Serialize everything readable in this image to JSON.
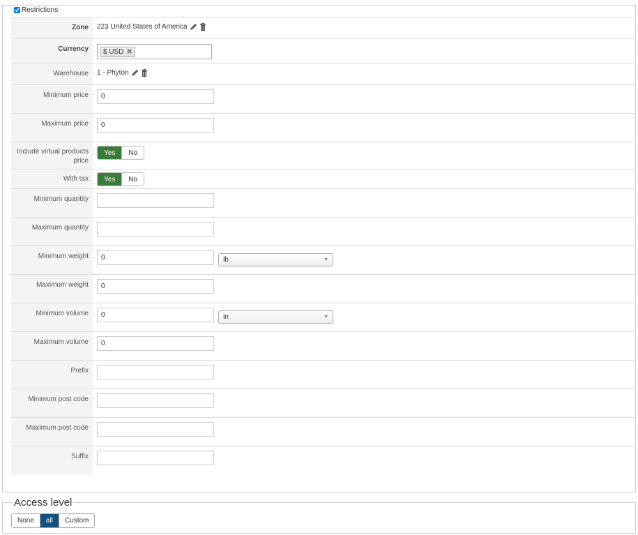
{
  "restrictions": {
    "legend": "Restrictions",
    "checked": true,
    "zone": {
      "label": "Zone",
      "value": "223 United States of America"
    },
    "currency": {
      "label": "Currency",
      "tag": "$ USD"
    },
    "warehouse": {
      "label": "Warehouse",
      "value": "1 - Phyton"
    },
    "minimum_price": {
      "label": "Minimum price",
      "value": "0"
    },
    "maximum_price": {
      "label": "Maximum price",
      "value": "0"
    },
    "include_virtual": {
      "label": "Include virtual products price",
      "yes": "Yes",
      "no": "No",
      "selected": "Yes"
    },
    "with_tax": {
      "label": "With tax",
      "yes": "Yes",
      "no": "No",
      "selected": "Yes"
    },
    "minimum_quantity": {
      "label": "Minimum quantity",
      "value": ""
    },
    "maximum_quantity": {
      "label": "Maximum quantity",
      "value": ""
    },
    "minimum_weight": {
      "label": "Minimum weight",
      "value": "0",
      "unit": "lb"
    },
    "maximum_weight": {
      "label": "Maximum weight",
      "value": "0"
    },
    "minimum_volume": {
      "label": "Minimum volume",
      "value": "0",
      "unit": "in"
    },
    "maximum_volume": {
      "label": "Maximum volume",
      "value": "0"
    },
    "prefix": {
      "label": "Prefix",
      "value": ""
    },
    "minimum_post_code": {
      "label": "Minimum post code",
      "value": ""
    },
    "maximum_post_code": {
      "label": "Maximum post code",
      "value": ""
    },
    "suffix": {
      "label": "Suffix",
      "value": ""
    }
  },
  "access_level": {
    "legend": "Access level",
    "options": [
      "None",
      "all",
      "Custom"
    ],
    "selected": "all"
  },
  "colors": {
    "yes_green": "#3a7d3a",
    "active_blue": "#164e7e"
  },
  "icons": [
    "pencil-icon",
    "trash-icon",
    "remove-x-icon",
    "dropdown-arrow-icon"
  ]
}
